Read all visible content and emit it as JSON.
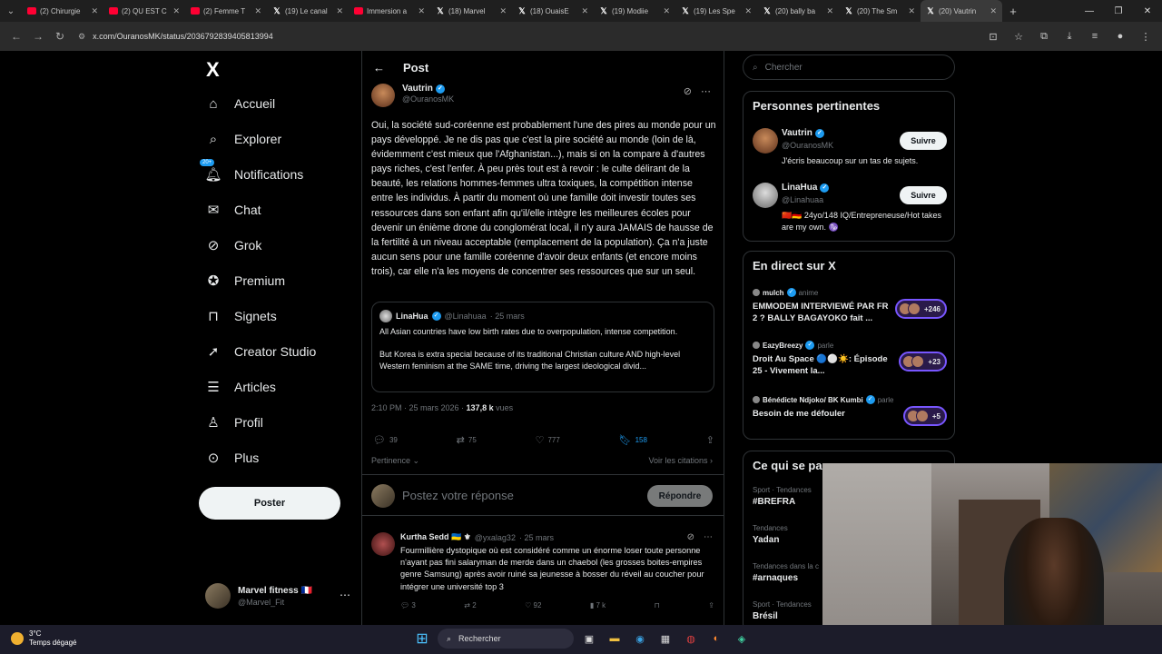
{
  "browser": {
    "tabs": [
      {
        "icon": "youtube",
        "title": "(2) Chirurgie"
      },
      {
        "icon": "youtube",
        "title": "(2) QU EST C"
      },
      {
        "icon": "youtube",
        "title": "(2) Femme T"
      },
      {
        "icon": "x",
        "title": "(19) Le canal"
      },
      {
        "icon": "youtube",
        "title": "Immersion a"
      },
      {
        "icon": "x",
        "title": "(18) Marvel"
      },
      {
        "icon": "x",
        "title": "(18) OuaisE"
      },
      {
        "icon": "x",
        "title": "(19) Modiie"
      },
      {
        "icon": "x",
        "title": "(19) Les Spe"
      },
      {
        "icon": "x",
        "title": "(20) bally ba"
      },
      {
        "icon": "x",
        "title": "(20) The Sm"
      },
      {
        "icon": "x",
        "title": "(20) Vautrin"
      }
    ],
    "active_tab_index": 11,
    "url": "x.com/OuranosMK/status/2036792839405813994"
  },
  "sidebar": {
    "logo": "X",
    "items": [
      {
        "label": "Accueil",
        "icon": "home-icon"
      },
      {
        "label": "Explorer",
        "icon": "search-icon"
      },
      {
        "label": "Notifications",
        "icon": "bell-icon",
        "badge": "20+"
      },
      {
        "label": "Chat",
        "icon": "mail-icon"
      },
      {
        "label": "Grok",
        "icon": "grok-icon"
      },
      {
        "label": "Premium",
        "icon": "premium-icon"
      },
      {
        "label": "Signets",
        "icon": "bookmark-icon"
      },
      {
        "label": "Creator Studio",
        "icon": "rocket-icon"
      },
      {
        "label": "Articles",
        "icon": "article-icon"
      },
      {
        "label": "Profil",
        "icon": "person-icon"
      },
      {
        "label": "Plus",
        "icon": "more-icon"
      }
    ],
    "post_button": "Poster",
    "account": {
      "name": "Marvel fitness 🇫🇷",
      "handle": "@Marvel_Fit"
    }
  },
  "main": {
    "header": "Post",
    "tweet": {
      "author": "Vautrin",
      "handle": "@OuranosMK",
      "text": "Oui, la société sud-coréenne est probablement l'une des pires au monde pour un pays développé. Je ne dis pas que c'est la pire société au monde (loin de là, évidemment c'est mieux que l'Afghanistan...), mais si on la compare à d'autres pays riches, c'est l'enfer. À peu près tout est à revoir : le culte délirant de la beauté, les relations hommes-femmes ultra toxiques, la compétition intense entre les individus. À partir du moment où une famille doit investir toutes ses ressources dans son enfant afin qu'il/elle intègre les meilleures écoles pour devenir un énième drone du conglomérat local, il n'y aura JAMAIS de hausse de la fertilité à un niveau acceptable (remplacement de la population). Ça n'a juste aucun sens pour une famille coréenne d'avoir deux enfants (et encore moins trois), car elle n'a les moyens de concentrer ses ressources que sur un seul.",
      "quote": {
        "author": "LinaHua",
        "handle": "@Linahuaa",
        "date": "· 25 mars",
        "text_1": "All Asian countries have low birth rates due to overpopulation, intense competition.",
        "text_2": "But Korea is extra special because of its traditional Christian culture AND high-level Western feminism at the SAME time, driving the largest ideological divid..."
      },
      "timestamp": "2:10 PM · 25 mars 2026 · ",
      "views_count": "137,8 k",
      "views_label": " vues",
      "replies": "39",
      "reposts": "75",
      "likes": "777",
      "bookmarks": "158"
    },
    "relevance_label": "Pertinence ⌄",
    "quotes_link": "Voir les citations ›",
    "reply_placeholder": "Postez votre réponse",
    "reply_button": "Répondre",
    "reply": {
      "author": "Kurtha Sedd 🇺🇦 ⚜",
      "handle": "@yxalag32",
      "date": "· 25 mars",
      "text": "Fourmillière dystopique où est considéré comme un énorme loser toute personne n'ayant pas fini salaryman de merde dans un chaebol (les grosses boites-empires genre Samsung) après avoir ruiné sa jeunesse à bosser du réveil au coucher pour intégrer une université top 3",
      "replies": "3",
      "reposts": "2",
      "likes": "92",
      "views": "7 k"
    }
  },
  "right": {
    "search_placeholder": "Chercher",
    "people_title": "Personnes pertinentes",
    "people": [
      {
        "name": "Vautrin",
        "handle": "@OuranosMK",
        "bio": "J'écris beaucoup sur un tas de sujets.",
        "follow": "Suivre"
      },
      {
        "name": "LinaHua",
        "handle": "@Linahuaa",
        "bio": "🇨🇳🇩🇪 24yo/148 IQ/Entrepreneuse/Hot takes are my own. ♑",
        "follow": "Suivre"
      }
    ],
    "live_title": "En direct sur X",
    "live": [
      {
        "host": "mulch",
        "verb": "anime",
        "title": "EMMODEM INTERVIEWÉ PAR FR 2 ? BALLY BAGAYOKO fait ...",
        "count": "+246"
      },
      {
        "host": "EazyBreezy",
        "verb": "parle",
        "title": "Droit Au Space 🔵⚪☀️: Épisode 25 - Vivement la...",
        "count": "+23"
      },
      {
        "host": "Bénédicte Ndjoko/ BK Kumbi",
        "verb": "parle",
        "title": "Besoin de me défouler",
        "count": "+5"
      }
    ],
    "trends_title": "Ce qui se passe",
    "trends": [
      {
        "context": "Sport · Tendances",
        "name": "#BREFRA"
      },
      {
        "context": "Tendances",
        "name": "Yadan"
      },
      {
        "context": "Tendances dans la c",
        "name": "#arnaques"
      },
      {
        "context": "Sport · Tendances",
        "name": "Brésil"
      }
    ]
  },
  "taskbar": {
    "temp": "3°C",
    "weather": "Temps dégagé",
    "search": "Rechercher"
  },
  "colors": {
    "accent": "#1d9bf0",
    "background": "#000000",
    "live_border": "#7856ff"
  }
}
